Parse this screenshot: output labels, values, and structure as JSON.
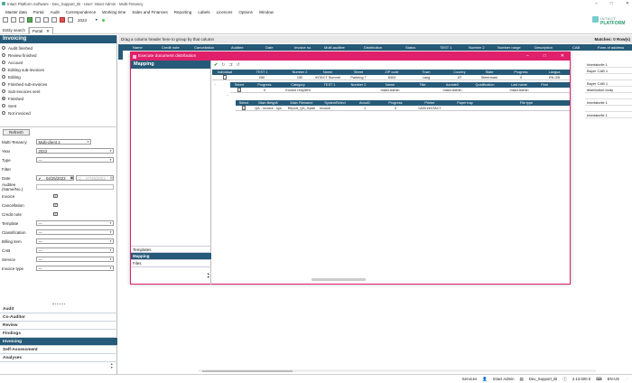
{
  "window": {
    "title": "Intact Platform Software - Dev_Support_BI - User: Intact Admin - Multi-Tenancy"
  },
  "menu": [
    "Master data",
    "Portal",
    "Audit",
    "Correspondence",
    "Working time",
    "Sales and Finances",
    "Reporting",
    "Labels",
    "Licences",
    "Options",
    "Window"
  ],
  "toolbar": {
    "year": "2023"
  },
  "logo": {
    "line1": "INTACT",
    "line2": "PLATFORM"
  },
  "tabs": [
    "Entity search",
    "Portal"
  ],
  "sidebar": {
    "section": "Invoicing",
    "radios": [
      {
        "label": "Audit finished",
        "on": false
      },
      {
        "label": "Review finished",
        "on": false
      },
      {
        "label": "Account",
        "on": false
      },
      {
        "label": "Editing sub-invoices",
        "on": false
      },
      {
        "label": "Editing",
        "on": false
      },
      {
        "label": "Finished sub-invoices",
        "on": false
      },
      {
        "label": "Sub-invoices sent",
        "on": false
      },
      {
        "label": "Finished",
        "on": true
      },
      {
        "label": "Sent",
        "on": false
      },
      {
        "label": "Not invoiced",
        "on": false
      }
    ],
    "refresh": "Refresh",
    "multi_tenancy_label": "Multi-Tenancy",
    "multi_tenancy_value": "Multi-client 1",
    "year_label": "Year",
    "year_value": "2023",
    "type_label": "Type",
    "type_value": "---",
    "filter_label": "Filter",
    "date_label": "Date",
    "date_from": "04/25/2023",
    "date_to": "07/25/2023",
    "auditee_label": "Auditee (Name/No.)",
    "invoice_label": "Invoice",
    "cancellation_label": "Cancellation",
    "credit_note_label": "Credit note",
    "template_label": "Template",
    "template_value": "---",
    "classification_label": "Classification",
    "classification_value": "---",
    "billing_item_label": "Billing item",
    "billing_item_value": "---",
    "cab_label": "CAB",
    "cab_value": "---",
    "service_label": "Service",
    "service_value": "---",
    "invoice_type_label": "Invoice type",
    "invoice_type_value": "---",
    "accordion": [
      "Audit",
      "Co-Auditor",
      "Review",
      "Findings",
      "Invoicing",
      "Self-Assessment",
      "Analyses"
    ],
    "accordion_active": "Invoicing"
  },
  "main": {
    "group_hint": "Drag a column header here to group by that column",
    "matches": "Matches: 0 Row(s)",
    "columns": [
      "Name",
      "Credit note",
      "Cancellation",
      "Auditee",
      "Date",
      "Invoice no.",
      "Multi-auditee",
      "Distribution",
      "Status",
      "TEST 1",
      "Number 2",
      "Number range",
      "Description",
      "CAB",
      "Form of address"
    ],
    "right_rows": [
      "Intertakelle 1",
      "Bayer CAB 1",
      "",
      "Bayer CAB 1",
      "distribution body",
      "",
      "Intertakelle 1",
      "",
      "Intertakelle 1"
    ]
  },
  "dialog": {
    "title": "Execute document distribution",
    "left_header": "Mapping",
    "left_items": [
      "Templates",
      "Mapping",
      "Files"
    ],
    "left_active": "Mapping",
    "g1": {
      "headers": [
        "Individual",
        "TEST 1",
        "Number 2",
        "Name",
        "Street",
        "ZIP code",
        "Town",
        "Country",
        "State",
        "Progress",
        "Langua"
      ],
      "row": [
        "",
        "260",
        "150",
        "INTACT Summit",
        "Parkring 7",
        "8403",
        "Lang",
        "AT",
        "Steiermark",
        "0",
        "EN-GB"
      ]
    },
    "g2": {
      "headers": [
        "Select",
        "Progress",
        "Category",
        "TEST 1",
        "Number 2",
        "Name",
        "Title",
        "Acrade2",
        "Qualification",
        "Last name",
        "First"
      ],
      "row": [
        "",
        "0",
        "Invoice recipient",
        "",
        "",
        "Intact Admin",
        "",
        "Intact Admin",
        "",
        "Intact Admin",
        ""
      ]
    },
    "g3": {
      "headers": [
        "Select",
        "Main filetyp8",
        "Main Filename",
        "SystemRelevl",
        "Amo#1",
        "Progress",
        "Printer",
        "Paper tray",
        "File type"
      ],
      "row": [
        "",
        "QA - invoice - sys",
        "Report_QA_Syste",
        "Invoice",
        "1",
        "0",
        "\\\\A001\\INTACT",
        "",
        ""
      ]
    }
  },
  "status": {
    "services": "Services",
    "user": "Intact Admin",
    "db": "Dev_Support_BI",
    "version": "2.13.500.0",
    "locale": "EN-US"
  }
}
